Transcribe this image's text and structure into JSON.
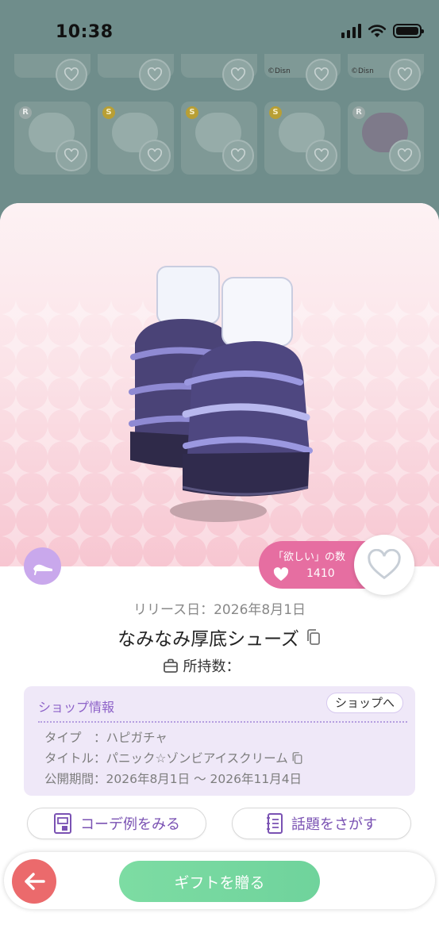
{
  "status_bar": {
    "time": "10:38",
    "icons": [
      "signal-icon",
      "wifi-icon",
      "battery-icon"
    ]
  },
  "background_grid": {
    "top_row": [
      {
        "caption": ""
      },
      {
        "caption": ""
      },
      {
        "caption": ""
      },
      {
        "caption": "©Disn"
      },
      {
        "caption": "©Disn"
      }
    ],
    "second_row": [
      {
        "rank": "R"
      },
      {
        "rank": "S"
      },
      {
        "rank": "S"
      },
      {
        "rank": "S"
      },
      {
        "rank": "R"
      }
    ]
  },
  "item": {
    "category_icon": "shoe-icon",
    "want_label": "「欲しい」の数",
    "want_count": "1410",
    "release_date": "リリース日：2026年8月1日",
    "name": "なみなみ厚底シューズ",
    "owned_label": "所持数："
  },
  "shop_info": {
    "title": "ショップ情報",
    "link_label": "ショップへ",
    "lines": [
      "タイプ　：ハピガチャ",
      "タイトル：パニック☆ゾンビアイスクリーム",
      "公開期間：2026年8月1日 〜 2026年11月4日"
    ]
  },
  "actions": {
    "coord_label": "コーデ例をみる",
    "topic_label": "話題をさがす"
  },
  "bottom_bar": {
    "gift_label": "ギフトを贈る"
  },
  "colors": {
    "overlay": "#6f8d8b",
    "want_pill": "#e66ea1",
    "accent_purple": "#8d62c8",
    "gift_green": "#72d69e",
    "back_red": "#eb6a6c",
    "badge_lilac": "#c9a8ec"
  }
}
